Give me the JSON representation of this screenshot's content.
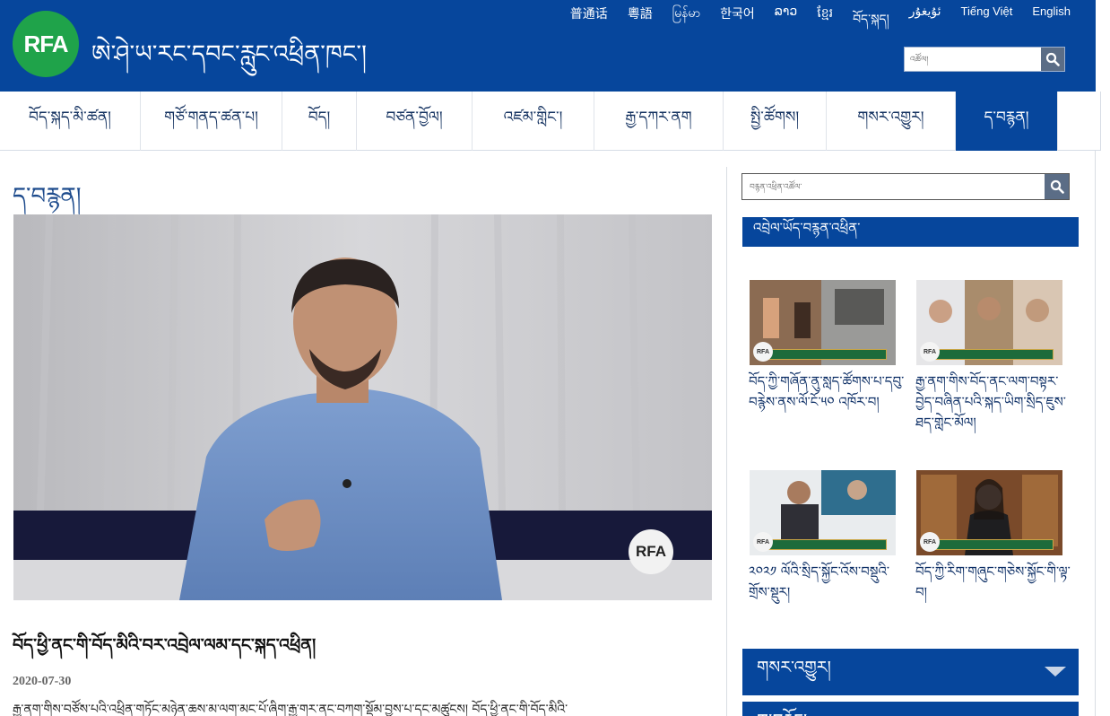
{
  "header": {
    "logo_text": "RFA",
    "site_title": "ཨེ་ཤེ་ཡ་རང་དབང་རླུང་འཕྲིན་ཁང་།",
    "languages": [
      "普通话",
      "粵語",
      "မြန်မာ",
      "한국어",
      "ລາວ",
      "ខ្មែរ",
      "བོད་སྐད།",
      "ئۇيغۇر",
      "Tiếng Việt",
      "English"
    ],
    "search_placeholder": "འཚོལ།"
  },
  "nav": {
    "items": [
      {
        "label": "བོད་སྐད་མི་ཚན།",
        "active": false
      },
      {
        "label": "གཙོ་གནད་ཚན་པ།",
        "active": false
      },
      {
        "label": "བོད།",
        "active": false
      },
      {
        "label": "བཙན་བྱོལ།",
        "active": false
      },
      {
        "label": "འཛམ་གླིང་།",
        "active": false
      },
      {
        "label": "རྒྱ་དཀར་ནག",
        "active": false
      },
      {
        "label": "སྤྱི་ཚོགས།",
        "active": false
      },
      {
        "label": "གསར་འགྱུར།",
        "active": false
      },
      {
        "label": "ད་བརྙན།",
        "active": true
      }
    ]
  },
  "main": {
    "page_heading": "ད་བརྙན།",
    "video_badge": "RFA",
    "headline": "བོད་ཕྱི་ནང་གི་བོད་མིའི་བར་འབྲེལ་ལམ་དང་སྐད་འཕྲིན།",
    "date": "2020-07-30",
    "summary": "རྒྱ་ནག་གིས་བཙོས་པའི་འཕྲིན་གཏོང་མཉེན་ཆས་མ་ལག་མང་པོ་ཞིག་རྒྱ་གར་ནང་བཀག་སྡོམ་བྱས་པ་དང་མཚུངས། བོད་ཕྱི་ནང་གི་བོད་མིའི་"
  },
  "sidebar": {
    "search_placeholder": "བརྙན་འཕྲིན་འཚོལ་",
    "featured_heading": "འབྲེལ་ཡོད་བརྙན་འཕྲིན་",
    "videos": [
      {
        "title": "བོད་ཀྱི་གཞོན་ནུ་སླད་ཚོགས་པ་དབུ་བརྙེས་ནས་ལོ་ངོ་༥༠ འཁོར་བ།"
      },
      {
        "title": "རྒྱ་ནག་གིས་བོད་ནང་ལག་བསྟར་བྱེད་བཞིན་པའི་སྐད་ཡིག་སྲིད་ཇུས་ཐད་གླེང་མོལ།"
      },
      {
        "title": "༢༠༢༡ ལོའི་སྲིད་སྐྱོང་འོས་བསྡུའི་གྲོས་སྡུར།"
      },
      {
        "title": "བོད་ཀྱི་རིག་གཞུང་གཅེས་སྐྱོང་གི་ལྟ་བ།"
      }
    ],
    "accordion": [
      "གསར་འགྱུར།",
      "ཁ་བརྗོད།"
    ]
  },
  "colors": {
    "header_blue": "#06469c",
    "logo_green": "#1fa34a",
    "link_blue": "#0d2f66"
  }
}
